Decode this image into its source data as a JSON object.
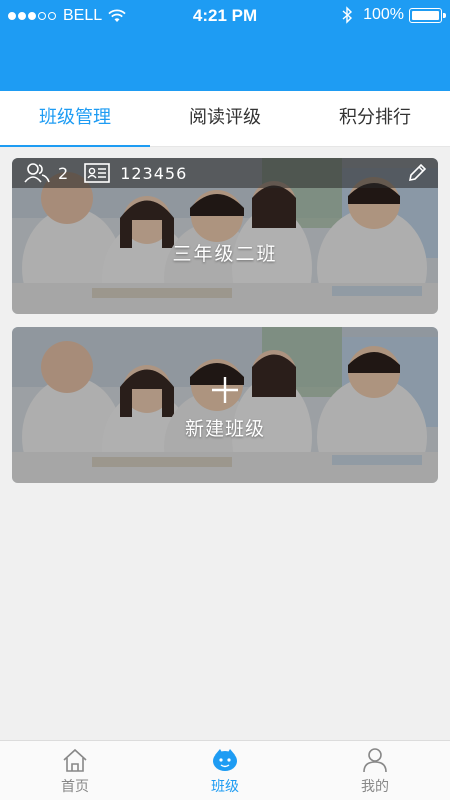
{
  "status_bar": {
    "carrier": "BELL",
    "time": "4:21 PM",
    "battery": "100%"
  },
  "tabs": [
    {
      "label": "班级管理",
      "active": true
    },
    {
      "label": "阅读评级",
      "active": false
    },
    {
      "label": "积分排行",
      "active": false
    }
  ],
  "classes": [
    {
      "members": "2",
      "code": "123456",
      "name": "三年级二班"
    }
  ],
  "new_class": {
    "label": "新建班级"
  },
  "bottom_nav": [
    {
      "label": "首页",
      "icon": "home-icon",
      "active": false
    },
    {
      "label": "班级",
      "icon": "class-icon",
      "active": true
    },
    {
      "label": "我的",
      "icon": "profile-icon",
      "active": false
    }
  ],
  "colors": {
    "accent": "#1e9cf3",
    "background": "#f0f0f0"
  }
}
